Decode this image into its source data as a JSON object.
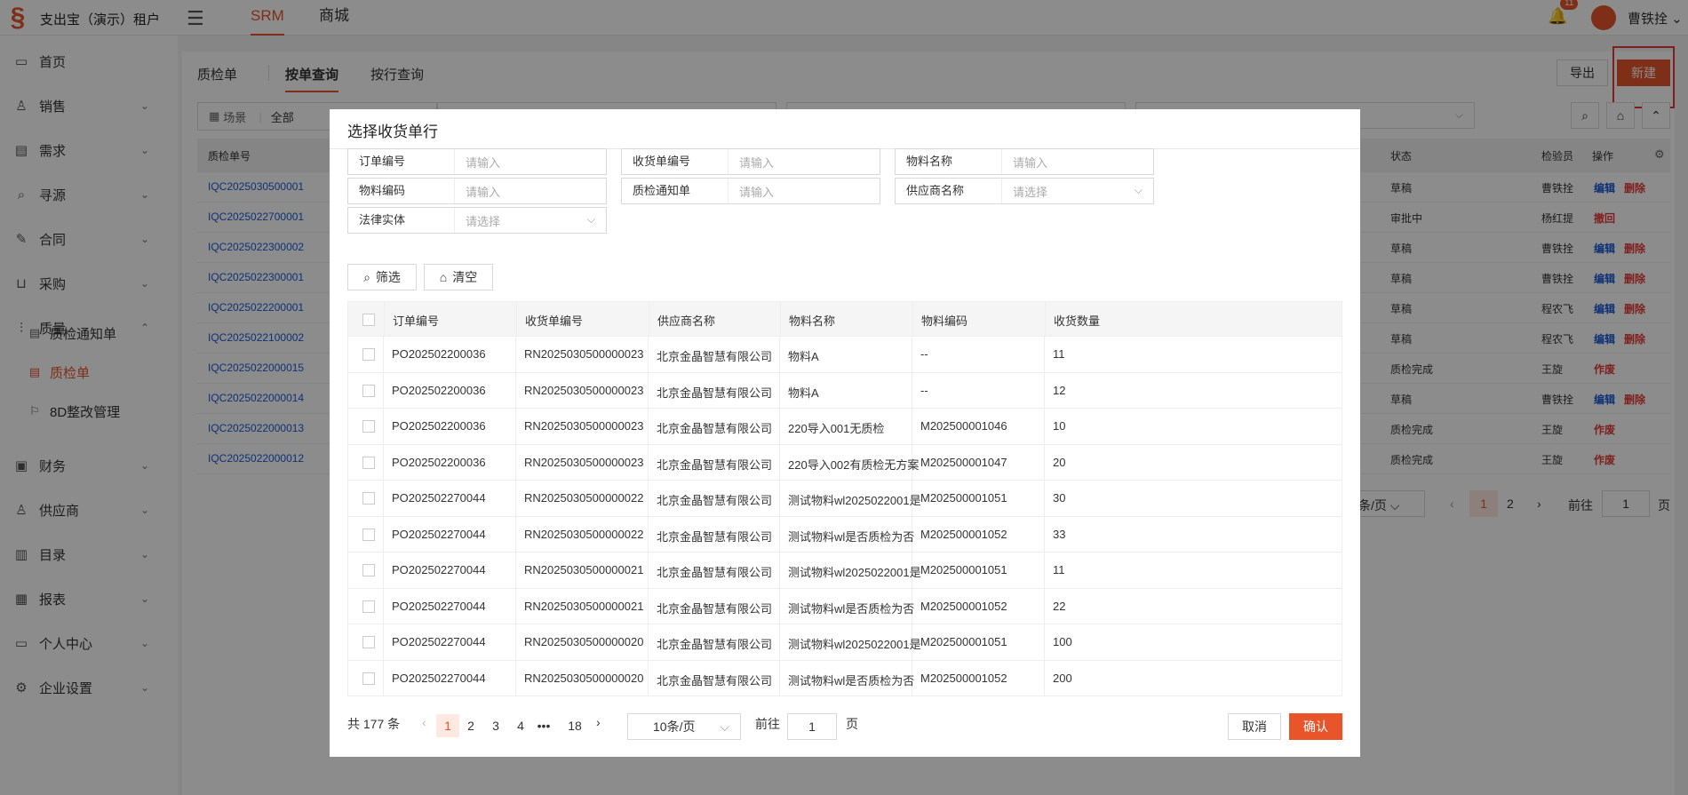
{
  "app": {
    "brand": "支出宝（演示）租户",
    "logo_icon": "logo-icon",
    "top_tabs": [
      "SRM",
      "商城"
    ],
    "notif_count": "11",
    "user": "曹铁拴"
  },
  "sidebar": {
    "items": [
      {
        "label": "首页",
        "icon": "monitor-icon",
        "expandable": false
      },
      {
        "label": "销售",
        "icon": "person-icon",
        "expandable": true
      },
      {
        "label": "需求",
        "icon": "clipboard-icon",
        "expandable": true
      },
      {
        "label": "寻源",
        "icon": "search-icon",
        "expandable": true
      },
      {
        "label": "合同",
        "icon": "pen-icon",
        "expandable": true
      },
      {
        "label": "采购",
        "icon": "cart-icon",
        "expandable": true
      },
      {
        "label": "质量",
        "icon": "sliders-icon",
        "expandable": true,
        "expanded": true
      },
      {
        "label": "财务",
        "icon": "wallet-icon",
        "expandable": true
      },
      {
        "label": "供应商",
        "icon": "person-icon",
        "expandable": true
      },
      {
        "label": "目录",
        "icon": "book-icon",
        "expandable": true
      },
      {
        "label": "报表",
        "icon": "report-icon",
        "expandable": true
      },
      {
        "label": "个人中心",
        "icon": "monitor-icon",
        "expandable": true
      },
      {
        "label": "企业设置",
        "icon": "gear-icon",
        "expandable": true
      }
    ],
    "sub_items": [
      {
        "label": "质检通知单",
        "active": false
      },
      {
        "label": "质检单",
        "active": true
      },
      {
        "label": "8D整改管理",
        "active": false
      }
    ]
  },
  "page": {
    "tabs": [
      "质检单",
      "按单查询",
      "按行查询"
    ],
    "active_tab": "按单查询",
    "export_label": "导出",
    "new_label": "新建",
    "scene_label": "场景",
    "scene_value": "全部"
  },
  "bg_table": {
    "headers": [
      "质检单号",
      "状态",
      "检验员",
      "操作"
    ],
    "rows": [
      {
        "no": "IQC2025030500001",
        "status": "草稿",
        "inspector": "曹铁拴",
        "actions": [
          "编辑",
          "删除"
        ]
      },
      {
        "no": "IQC2025022700001",
        "status": "审批中",
        "inspector": "杨红提",
        "actions": [
          "撤回"
        ]
      },
      {
        "no": "IQC2025022300002",
        "status": "草稿",
        "inspector": "曹铁拴",
        "actions": [
          "编辑",
          "删除"
        ]
      },
      {
        "no": "IQC2025022300001",
        "status": "草稿",
        "inspector": "曹铁拴",
        "actions": [
          "编辑",
          "删除"
        ]
      },
      {
        "no": "IQC2025022200001",
        "status": "草稿",
        "inspector": "程农飞",
        "actions": [
          "编辑",
          "删除"
        ]
      },
      {
        "no": "IQC2025022100002",
        "status": "草稿",
        "inspector": "程农飞",
        "actions": [
          "编辑",
          "删除"
        ]
      },
      {
        "no": "IQC2025022000015",
        "status": "质检完成",
        "inspector": "王旋",
        "actions": [
          "作废"
        ]
      },
      {
        "no": "IQC2025022000014",
        "status": "草稿",
        "inspector": "曹铁拴",
        "actions": [
          "编辑",
          "删除"
        ]
      },
      {
        "no": "IQC2025022000013",
        "status": "质检完成",
        "inspector": "王旋",
        "actions": [
          "作废"
        ]
      },
      {
        "no": "IQC2025022000012",
        "status": "质检完成",
        "inspector": "王旋",
        "actions": [
          "作废"
        ]
      }
    ],
    "pager": {
      "per_page": "条/页",
      "pages": [
        "1",
        "2"
      ],
      "goto": "前往",
      "goto_value": "1",
      "page_suffix": "页"
    }
  },
  "modal": {
    "title": "选择收货单行",
    "filters": [
      {
        "label": "订单编号",
        "placeholder": "请输入",
        "select": false
      },
      {
        "label": "收货单编号",
        "placeholder": "请输入",
        "select": false
      },
      {
        "label": "物料名称",
        "placeholder": "请输入",
        "select": false
      },
      {
        "label": "物料编码",
        "placeholder": "请输入",
        "select": false
      },
      {
        "label": "质检通知单",
        "placeholder": "请输入",
        "select": false
      },
      {
        "label": "供应商名称",
        "placeholder": "请选择",
        "select": true
      },
      {
        "label": "法律实体",
        "placeholder": "请选择",
        "select": true
      }
    ],
    "filter_btn": "筛选",
    "clear_btn": "清空",
    "columns": [
      "订单编号",
      "收货单编号",
      "供应商名称",
      "物料名称",
      "物料编码",
      "收货数量"
    ],
    "rows": [
      [
        "PO202502200036",
        "RN2025030500000023",
        "北京金晶智慧有限公司",
        "物料A",
        "--",
        "11"
      ],
      [
        "PO202502200036",
        "RN2025030500000023",
        "北京金晶智慧有限公司",
        "物料A",
        "--",
        "12"
      ],
      [
        "PO202502200036",
        "RN2025030500000023",
        "北京金晶智慧有限公司",
        "220导入001无质检",
        "M202500001046",
        "10"
      ],
      [
        "PO202502200036",
        "RN2025030500000023",
        "北京金晶智慧有限公司",
        "220导入002有质检无方案",
        "M202500001047",
        "20"
      ],
      [
        "PO202502270044",
        "RN2025030500000022",
        "北京金晶智慧有限公司",
        "测试物料wl2025022001是...",
        "M202500001051",
        "30"
      ],
      [
        "PO202502270044",
        "RN2025030500000022",
        "北京金晶智慧有限公司",
        "测试物料wl是否质检为否",
        "M202500001052",
        "33"
      ],
      [
        "PO202502270044",
        "RN2025030500000021",
        "北京金晶智慧有限公司",
        "测试物料wl2025022001是...",
        "M202500001051",
        "11"
      ],
      [
        "PO202502270044",
        "RN2025030500000021",
        "北京金晶智慧有限公司",
        "测试物料wl是否质检为否",
        "M202500001052",
        "22"
      ],
      [
        "PO202502270044",
        "RN2025030500000020",
        "北京金晶智慧有限公司",
        "测试物料wl2025022001是...",
        "M202500001051",
        "100"
      ],
      [
        "PO202502270044",
        "RN2025030500000020",
        "北京金晶智慧有限公司",
        "测试物料wl是否质检为否",
        "M202500001052",
        "200"
      ]
    ],
    "total": "共 177 条",
    "pages": [
      "1",
      "2",
      "3",
      "4",
      "•••",
      "18"
    ],
    "active_page": "1",
    "per_page": "10条/页",
    "goto": "前往",
    "goto_value": "1",
    "page_suffix": "页",
    "cancel": "取消",
    "confirm": "确认"
  },
  "colors": {
    "accent": "#e8552a",
    "link": "#1a5bd6",
    "danger": "#e53935"
  }
}
